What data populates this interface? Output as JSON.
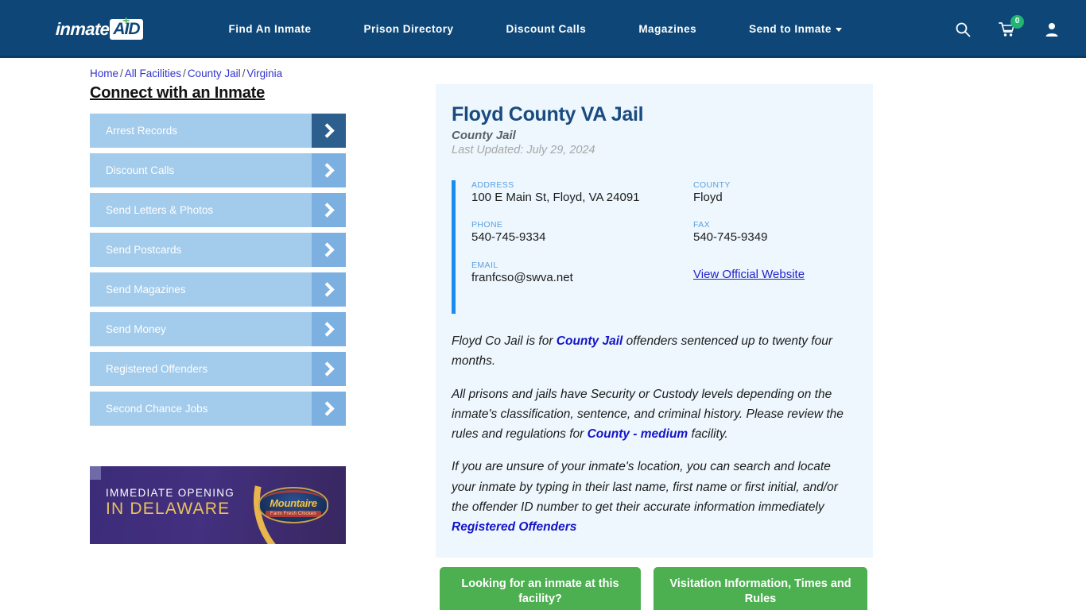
{
  "header": {
    "logo": {
      "word": "inmate",
      "badge": "AID",
      "plus": "+"
    },
    "nav": [
      {
        "label": "Find An Inmate",
        "has_caret": false
      },
      {
        "label": "Prison Directory",
        "has_caret": false
      },
      {
        "label": "Discount Calls",
        "has_caret": false
      },
      {
        "label": "Magazines",
        "has_caret": false
      },
      {
        "label": "Send to Inmate",
        "has_caret": true
      }
    ],
    "icons": {
      "search": "search-icon",
      "cart": "shopping-cart-icon",
      "cart_count": "0",
      "account": "user-account-icon"
    },
    "colors": {
      "background": "#0e4777",
      "badge": "#21b573"
    }
  },
  "breadcrumb": {
    "items": [
      "Home",
      "All Facilities",
      "County Jail",
      "Virginia"
    ],
    "separator": "/"
  },
  "sidebar": {
    "title": "Connect with an Inmate",
    "items": [
      {
        "label": "Arrest Records",
        "active": true
      },
      {
        "label": "Discount Calls",
        "active": false
      },
      {
        "label": "Send Letters & Photos",
        "active": false
      },
      {
        "label": "Send Postcards",
        "active": false
      },
      {
        "label": "Send Magazines",
        "active": false
      },
      {
        "label": "Send Money",
        "active": false
      },
      {
        "label": "Registered Offenders",
        "active": false
      },
      {
        "label": "Second Chance Jobs",
        "active": false
      }
    ],
    "ad": {
      "line1": "IMMEDIATE OPENING",
      "line2": "IN DELAWARE",
      "logo_name": "Mountaire",
      "logo_sub": "Farm Fresh Chicken"
    }
  },
  "facility": {
    "name": "Floyd County VA Jail",
    "type": "County Jail",
    "updated": "Last Updated: July 29, 2024",
    "fields": {
      "address_label": "ADDRESS",
      "address_value": "100 E Main St, Floyd, VA 24091",
      "county_label": "COUNTY",
      "county_value": "Floyd",
      "phone_label": "PHONE",
      "phone_value": "540-745-9334",
      "fax_label": "FAX",
      "fax_value": "540-745-9349",
      "email_label": "EMAIL",
      "email_value": "franfcso@swva.net",
      "website_link": "View Official Website"
    },
    "description": {
      "p1_a": "Floyd Co Jail is for ",
      "p1_link": "County Jail",
      "p1_b": " offenders sentenced up to twenty four months.",
      "p2_a": "All prisons and jails have Security or Custody levels depending on the inmate's classification, sentence, and criminal history. Please review the rules and regulations for ",
      "p2_link": "County - medium",
      "p2_b": " facility.",
      "p3_a": "If you are unsure of your inmate's location, you can search and locate your inmate by typing in their last name, first name or first initial, and/or the offender ID number to get their accurate information immediately",
      "p3_link": "Registered Offenders"
    }
  },
  "cta": {
    "primary": "Looking for an inmate at this facility?",
    "secondary": "Visitation Information, Times and Rules",
    "color": "#4caf50"
  }
}
